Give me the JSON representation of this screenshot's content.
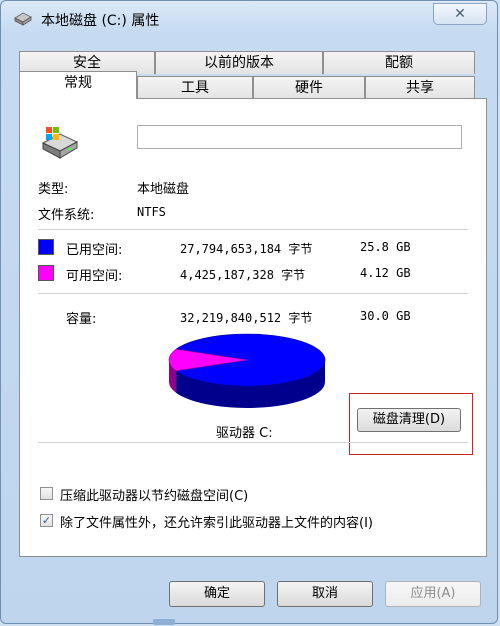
{
  "window": {
    "title": "本地磁盘 (C:) 属性",
    "close_glyph": "✕"
  },
  "tabs": {
    "row1": [
      "安全",
      "以前的版本",
      "配额"
    ],
    "row2": [
      "常规",
      "工具",
      "硬件",
      "共享"
    ],
    "active": "常规"
  },
  "general": {
    "name_value": "",
    "type_label": "类型:",
    "type_value": "本地磁盘",
    "fs_label": "文件系统:",
    "fs_value": "NTFS",
    "used_label": "已用空间:",
    "used_bytes": "27,794,653,184 字节",
    "used_size": "25.8 GB",
    "free_label": "可用空间:",
    "free_bytes": "4,425,187,328 字节",
    "free_size": "4.12 GB",
    "capacity_label": "容量:",
    "capacity_bytes": "32,219,840,512 字节",
    "capacity_size": "30.0 GB",
    "drive_label": "驱动器 C:",
    "cleanup_button": "磁盘清理(D)",
    "compress_label": "压缩此驱动器以节约磁盘空间(C)",
    "compress_checked": false,
    "index_label": "除了文件属性外，还允许索引此驱动器上文件的内容(I)",
    "index_checked": true
  },
  "colors": {
    "used": "#0000ff",
    "free": "#ff00ff",
    "highlight": "#d42020"
  },
  "usage": {
    "used_fraction": 0.863,
    "free_fraction": 0.137
  },
  "buttons": {
    "ok": "确定",
    "cancel": "取消",
    "apply": "应用(A)"
  },
  "icons": {
    "title": "drive-icon",
    "drive": "drive-icon",
    "close": "close-icon",
    "check": "✓"
  }
}
